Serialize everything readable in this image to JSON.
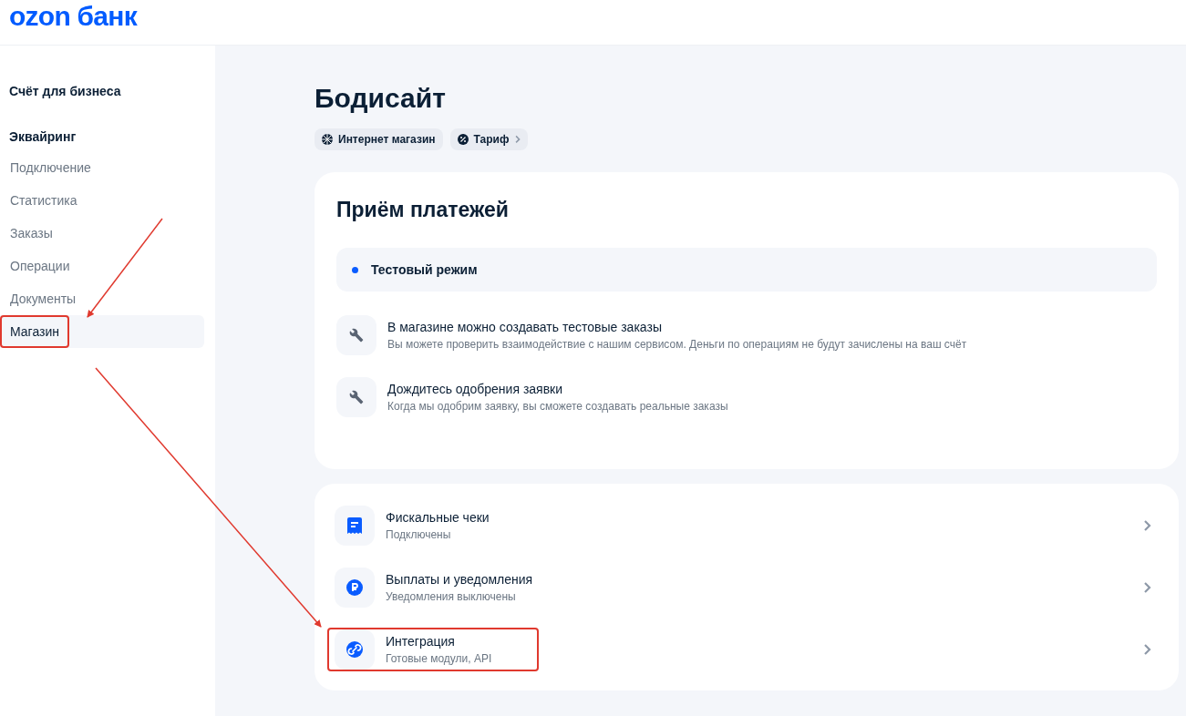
{
  "logo": "ozon банк",
  "sidebar": {
    "sections": [
      {
        "title": "Счёт для бизнеса"
      },
      {
        "title": "Эквайринг",
        "items": [
          {
            "label": "Подключение",
            "selected": false,
            "annotated": false
          },
          {
            "label": "Статистика",
            "selected": false,
            "annotated": false
          },
          {
            "label": "Заказы",
            "selected": false,
            "annotated": false
          },
          {
            "label": "Операции",
            "selected": false,
            "annotated": false
          },
          {
            "label": "Документы",
            "selected": false,
            "annotated": false
          },
          {
            "label": "Магазин",
            "selected": true,
            "annotated": true
          }
        ]
      }
    ]
  },
  "page": {
    "title": "Бодисайт",
    "chips": [
      {
        "label": "Интернет магазин",
        "kind": "store"
      },
      {
        "label": "Тариф",
        "kind": "tariff"
      }
    ]
  },
  "payments": {
    "title": "Приём платежей",
    "status": "Тестовый режим",
    "steps": [
      {
        "title": "В магазине можно создавать тестовые заказы",
        "description": "Вы можете проверить взаимодействие с нашим сервисом. Деньги по операциям не будут зачислены на ваш счёт"
      },
      {
        "title": "Дождитесь одобрения заявки",
        "description": "Когда мы одобрим заявку, вы сможете создавать реальные заказы"
      }
    ]
  },
  "settings": [
    {
      "title": "Фискальные чеки",
      "subtitle": "Подключены",
      "kind": "receipt",
      "annotated": false
    },
    {
      "title": "Выплаты и уведомления",
      "subtitle": "Уведомления выключены",
      "kind": "ruble",
      "annotated": false
    },
    {
      "title": "Интеграция",
      "subtitle": "Готовые модули, API",
      "kind": "link",
      "annotated": true
    }
  ]
}
